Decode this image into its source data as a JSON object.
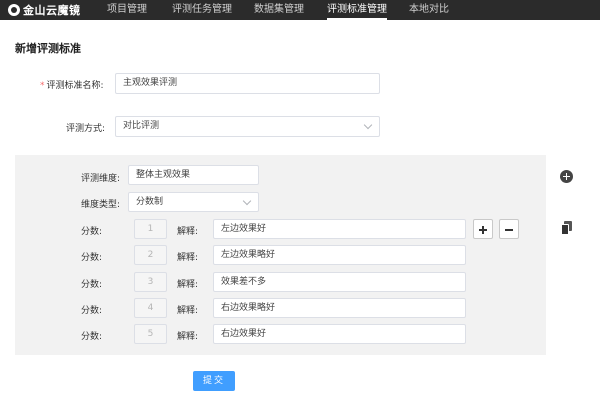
{
  "header": {
    "logo_text": "金山云魔镜",
    "nav": [
      "项目管理",
      "评测任务管理",
      "数据集管理",
      "评测标准管理",
      "本地对比"
    ],
    "active_index": 3
  },
  "page": {
    "title": "新增评测标准"
  },
  "form": {
    "name_label": "评测标准名称:",
    "name_value": "主观效果评测",
    "method_label": "评测方式:",
    "method_value": "对比评测"
  },
  "dimension": {
    "dim_label": "评测维度:",
    "dim_value": "整体主观效果",
    "type_label": "维度类型:",
    "type_value": "分数制",
    "score_label": "分数:",
    "explain_label": "解释:",
    "rows": [
      {
        "score": "1",
        "explain": "左边效果好"
      },
      {
        "score": "2",
        "explain": "左边效果略好"
      },
      {
        "score": "3",
        "explain": "效果差不多"
      },
      {
        "score": "4",
        "explain": "右边效果略好"
      },
      {
        "score": "5",
        "explain": "右边效果好"
      }
    ]
  },
  "actions": {
    "submit_label": "提交"
  },
  "colors": {
    "topbar": "#2b2b2b",
    "primary": "#409eff",
    "panel": "#f2f2f2",
    "required": "#f56c6c"
  }
}
